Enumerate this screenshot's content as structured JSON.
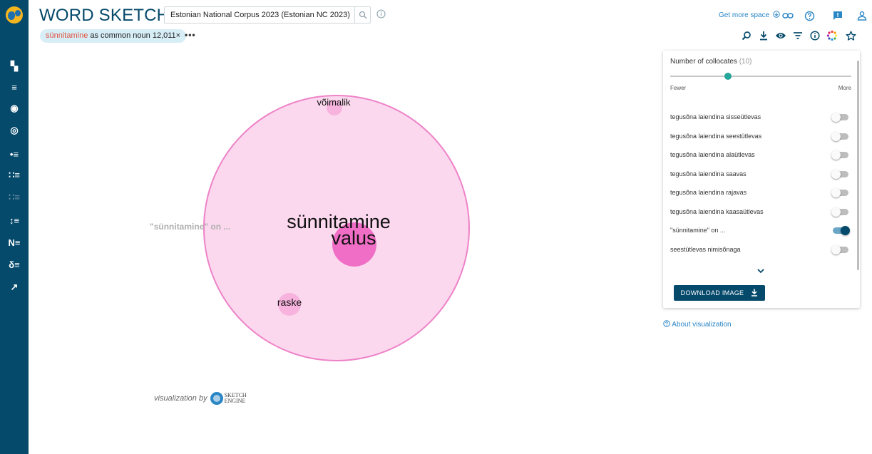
{
  "app": {
    "title": "WORD SKETCH",
    "corpus_value": "Estonian National Corpus 2023 (Estonian NC 2023)"
  },
  "query_chip": {
    "lemma": "sünnitamine",
    "rest": " as common noun 12,011×"
  },
  "header_right": {
    "get_more_space": "Get more space"
  },
  "sidebar": {
    "items": [
      {
        "icon": "dashboard-icon",
        "label": "▚"
      },
      {
        "icon": "list-icon",
        "label": "≡"
      },
      {
        "icon": "word-sketch-icon",
        "label": "◉"
      },
      {
        "icon": "sketch-diff-icon",
        "label": "◎"
      },
      {
        "icon": "thesaurus-icon",
        "label": "•≡"
      },
      {
        "icon": "concordance-icon",
        "label": "∷≡"
      },
      {
        "icon": "parallel-icon",
        "label": "∷≡"
      },
      {
        "icon": "wordlist-icon",
        "label": "↕≡"
      },
      {
        "icon": "ngrams-icon",
        "label": "N≡"
      },
      {
        "icon": "keywords-icon",
        "label": "δ≡"
      },
      {
        "icon": "trends-icon",
        "label": "↗"
      }
    ]
  },
  "visualization": {
    "center_word": "sünnitamine",
    "relation_label": "\"sünnitamine\" on ...",
    "collocates": [
      "võimalik",
      "valus",
      "raske"
    ],
    "credit_text": "visualization by",
    "logo_text_1": "SKETCH",
    "logo_text_2": "ENGINE",
    "colors": {
      "circle_fill": "#fbd8ee",
      "circle_stroke": "#ee82c8",
      "dot": "#f06ec6",
      "dot_light": "#f7b3de"
    }
  },
  "panel": {
    "collocates_label": "Number of collocates",
    "collocates_count": "(10)",
    "collocates_fraction": 0.32,
    "fewer": "Fewer",
    "more": "More",
    "relations": [
      {
        "label": "tegusõna laiendina sisseütlevas",
        "on": false
      },
      {
        "label": "tegusõna laiendina seestütlevas",
        "on": false
      },
      {
        "label": "tegusõna laiendina alaütlevas",
        "on": false
      },
      {
        "label": "tegusõna laiendina saavas",
        "on": false
      },
      {
        "label": "tegusõna laiendina rajavas",
        "on": false
      },
      {
        "label": "tegusõna laiendina kaasaütlevas",
        "on": false
      },
      {
        "label": "\"sünnitamine\" on ...",
        "on": true
      },
      {
        "label": "seestütlevas  nimisõnaga",
        "on": false
      }
    ],
    "download_label": "DOWNLOAD IMAGE"
  },
  "about_link": "About visualization",
  "accent": "#05496b"
}
